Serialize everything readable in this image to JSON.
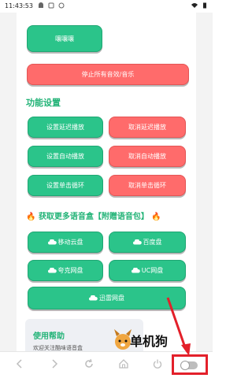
{
  "status_bar": {
    "time": "11:43:53"
  },
  "buttons": {
    "rara": "嚷嚷嚷",
    "stop_all": "停止所有音效/音乐",
    "set_delay": "设置延迟播放",
    "cancel_delay": "取消延迟播放",
    "set_auto": "设置自动播放",
    "cancel_auto": "取消自动播放",
    "set_loop": "设置单击循环",
    "cancel_loop": "取消单击循环"
  },
  "sections": {
    "settings_title": "功能设置",
    "promo_title": "获取更多语音盒【附赠语音包】",
    "help_title": "使用帮助",
    "help_text": "欢迎关注酷味语音盒"
  },
  "clouds": {
    "mobile": "移动云盘",
    "baidu": "百度盘",
    "quark": "夸克网盘",
    "uc": "UC网盘",
    "xunlei": "迅雷网盘"
  },
  "watermark": {
    "text": "单机狗"
  },
  "colors": {
    "green": "#2bc48a",
    "red": "#ff6b6b",
    "title_green": "#22b377",
    "highlight_red": "#e3202a"
  }
}
